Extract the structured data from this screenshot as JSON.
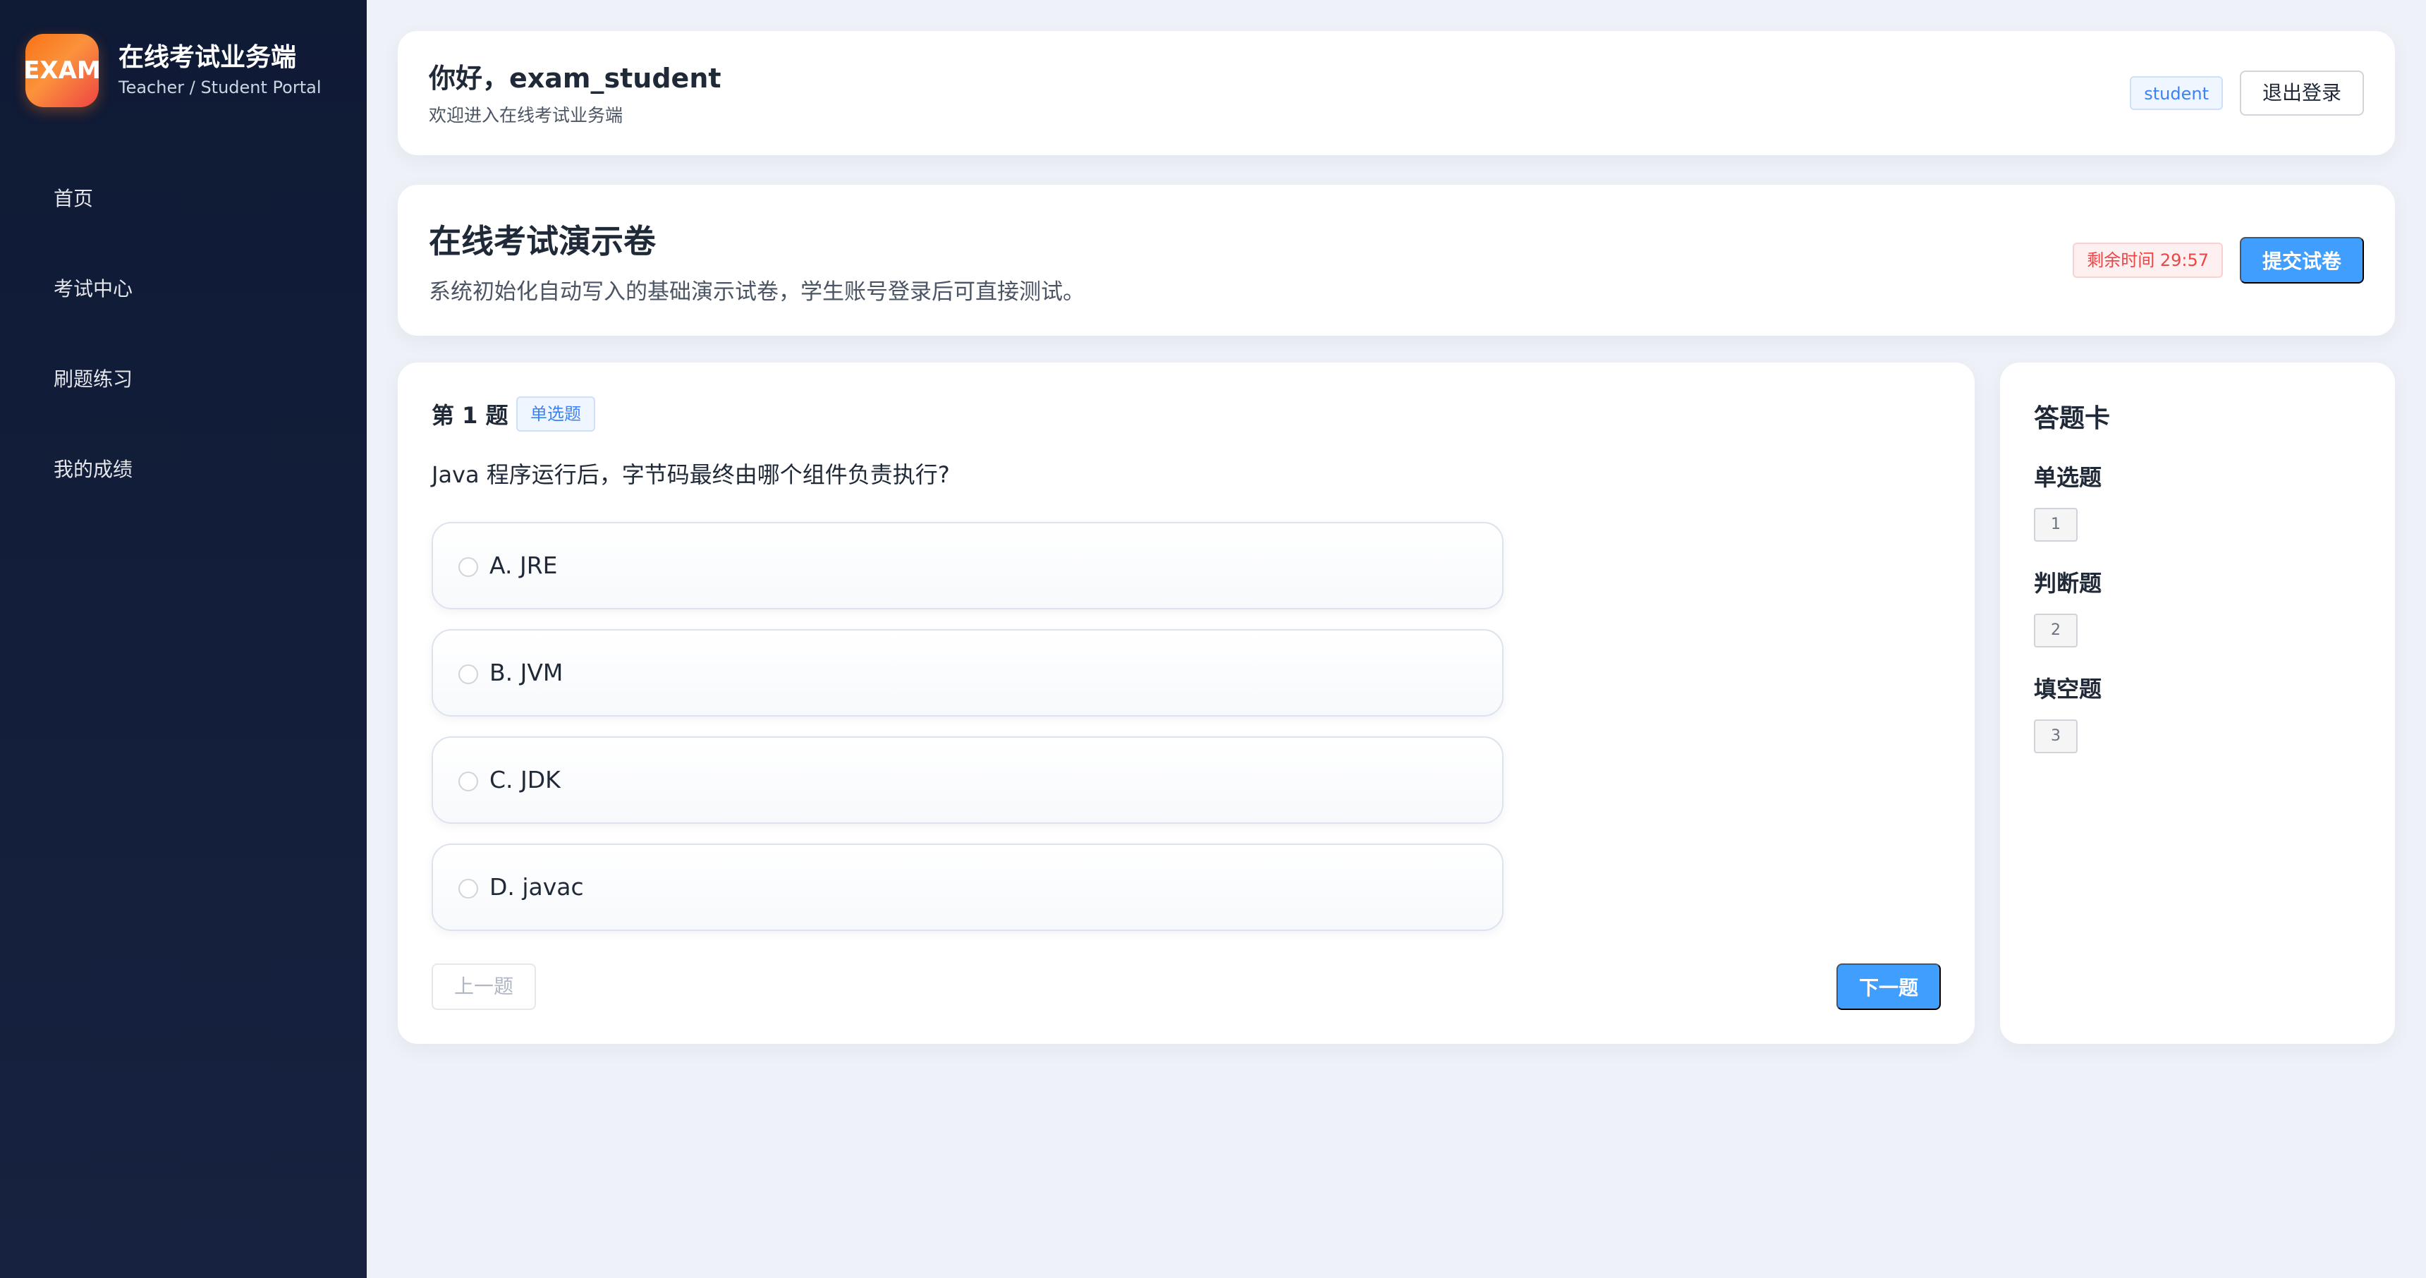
{
  "sidebar": {
    "logo_text": "EXAM",
    "title": "在线考试业务端",
    "subtitle": "Teacher / Student Portal",
    "items": [
      {
        "label": "首页"
      },
      {
        "label": "考试中心"
      },
      {
        "label": "刷题练习"
      },
      {
        "label": "我的成绩"
      }
    ]
  },
  "header": {
    "greeting": "你好，exam_student",
    "welcome": "欢迎进入在线考试业务端",
    "role": "student",
    "logout_label": "退出登录"
  },
  "exam": {
    "title": "在线考试演示卷",
    "description": "系统初始化自动写入的基础演示试卷，学生账号登录后可直接测试。",
    "timer": "剩余时间 29:57",
    "submit_label": "提交试卷"
  },
  "question": {
    "number": "第 1 题",
    "type": "单选题",
    "text": "Java 程序运行后，字节码最终由哪个组件负责执行?",
    "options": [
      {
        "label": "A. JRE"
      },
      {
        "label": "B. JVM"
      },
      {
        "label": "C. JDK"
      },
      {
        "label": "D. javac"
      }
    ],
    "prev_label": "上一题",
    "next_label": "下一题"
  },
  "answer_sheet": {
    "title": "答题卡",
    "groups": [
      {
        "title": "单选题",
        "questions": [
          "1"
        ]
      },
      {
        "title": "判断题",
        "questions": [
          "2"
        ]
      },
      {
        "title": "填空题",
        "questions": [
          "3"
        ]
      }
    ]
  },
  "colors": {
    "sidebar_bg": "#0f1a35",
    "primary": "#409eff",
    "danger": "#ef4444",
    "page_bg": "#eef2f8"
  }
}
